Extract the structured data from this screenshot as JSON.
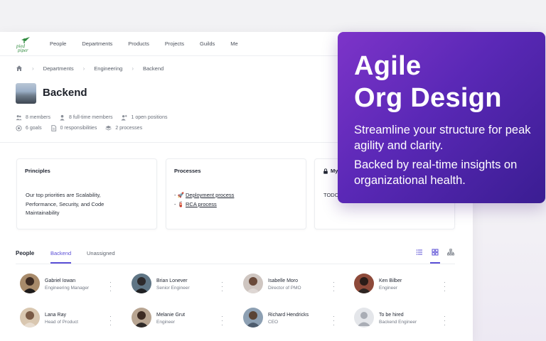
{
  "nav": {
    "logo_text": "pied piper",
    "links": [
      "People",
      "Departments",
      "Products",
      "Projects",
      "Guilds",
      "Me"
    ]
  },
  "breadcrumb": [
    "Departments",
    "Engineering",
    "Backend"
  ],
  "team": {
    "title": "Backend",
    "stats_row1": [
      "8 members",
      "8 full-time members",
      "1 open positions"
    ],
    "stats_row2": [
      "6 goals",
      "0 responsibilities",
      "2 processes"
    ]
  },
  "cards": {
    "principles": {
      "title": "Principles",
      "lines": [
        "Our top priorities are Scalability,",
        "Performance, Security, and Code",
        "Maintainability"
      ]
    },
    "processes": {
      "title": "Processes",
      "items": [
        {
          "prefix": "- 🚀 ",
          "link": "Deployment process"
        },
        {
          "prefix": "- 🧯 ",
          "link": "RCA process"
        }
      ]
    },
    "third": {
      "title": "My",
      "body": "TODO"
    }
  },
  "people_section": {
    "title": "People",
    "tabs": [
      "Backend",
      "Unassigned"
    ],
    "active_tab": "Backend",
    "members": [
      {
        "name": "Gabriel Iowan",
        "role": "Engineering Manager"
      },
      {
        "name": "Brian Lonever",
        "role": "Senior Engineer"
      },
      {
        "name": "Isabelle Moro",
        "role": "Director of PMO"
      },
      {
        "name": "Ken Bilber",
        "role": "Engineer"
      },
      {
        "name": "Lana Ray",
        "role": "Head of Product"
      },
      {
        "name": "Melanie Grut",
        "role": "Engineer"
      },
      {
        "name": "Richard Hendricks",
        "role": "CEO"
      },
      {
        "name": "To be hired",
        "role": "Backend Engineer"
      }
    ]
  },
  "promo": {
    "headline_line1": "Agile",
    "headline_line2": "Org Design",
    "paragraph1": "Streamline your structure for peak agility and clarity.",
    "paragraph2": "Backed by real-time insights on organizational health."
  },
  "colors": {
    "accent": "#5b4fd6",
    "promo_gradient_start": "#7d34c9",
    "promo_gradient_end": "#3a1d92",
    "logo_green": "#2f8a3e"
  }
}
